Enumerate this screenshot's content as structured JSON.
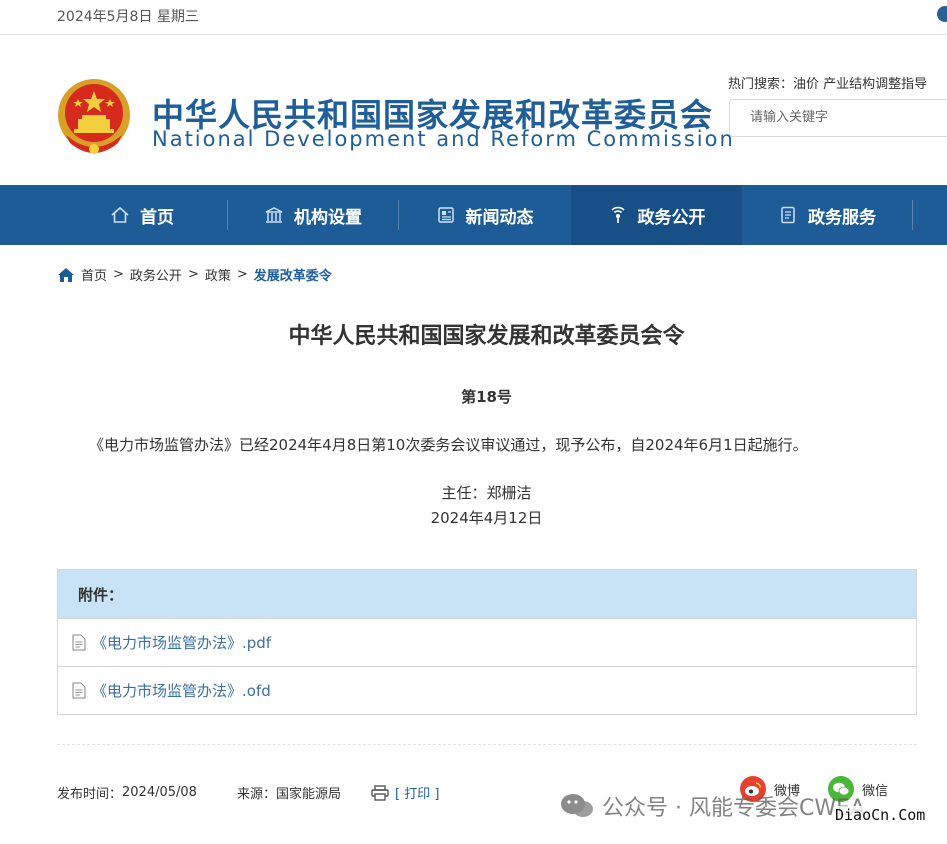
{
  "topbar": {
    "date": "2024年5月8日 星期三"
  },
  "header": {
    "title_cn": "中华人民共和国国家发展和改革委员会",
    "title_en": "National Development and Reform Commission",
    "hot_search_label": "热门搜索：",
    "hot_search_terms": "油价   产业结构调整指导",
    "search_placeholder": "请输入关键字"
  },
  "nav": {
    "items": [
      {
        "label": "首页",
        "icon": "home-icon"
      },
      {
        "label": "机构设置",
        "icon": "building-icon"
      },
      {
        "label": "新闻动态",
        "icon": "newspaper-icon"
      },
      {
        "label": "政务公开",
        "icon": "broadcast-icon",
        "active": true
      },
      {
        "label": "政务服务",
        "icon": "document-icon"
      }
    ]
  },
  "breadcrumb": {
    "items": [
      "首页",
      "政务公开",
      "政策"
    ],
    "separator": ">",
    "current": "发展改革委令"
  },
  "document": {
    "title": "中华人民共和国国家发展和改革委员会令",
    "number": "第18号",
    "body": "《电力市场监管办法》已经2024年4月8日第10次委务会议审议通过，现予公布，自2024年6月1日起施行。",
    "signatory": "主任：郑栅洁",
    "date": "2024年4月12日"
  },
  "attachments": {
    "header": "附件：",
    "files": [
      {
        "name": "《电力市场监管办法》.pdf"
      },
      {
        "name": "《电力市场监管办法》.ofd"
      }
    ]
  },
  "footer": {
    "publish_label": "发布时间：",
    "publish_date": "2024/05/08",
    "source_label": "来源：",
    "source": "国家能源局",
    "print_label": "[ 打印 ]",
    "share_weibo": "微博",
    "share_wechat": "微信"
  },
  "watermark": {
    "text": "公众号 · 风能专委会CWEA",
    "site": "DiaoCn.Com"
  },
  "colors": {
    "brand_blue": "#1e5c98",
    "nav_active": "#184f86",
    "attachment_header": "#c8e3f6",
    "link_blue": "#3b6fa0"
  }
}
